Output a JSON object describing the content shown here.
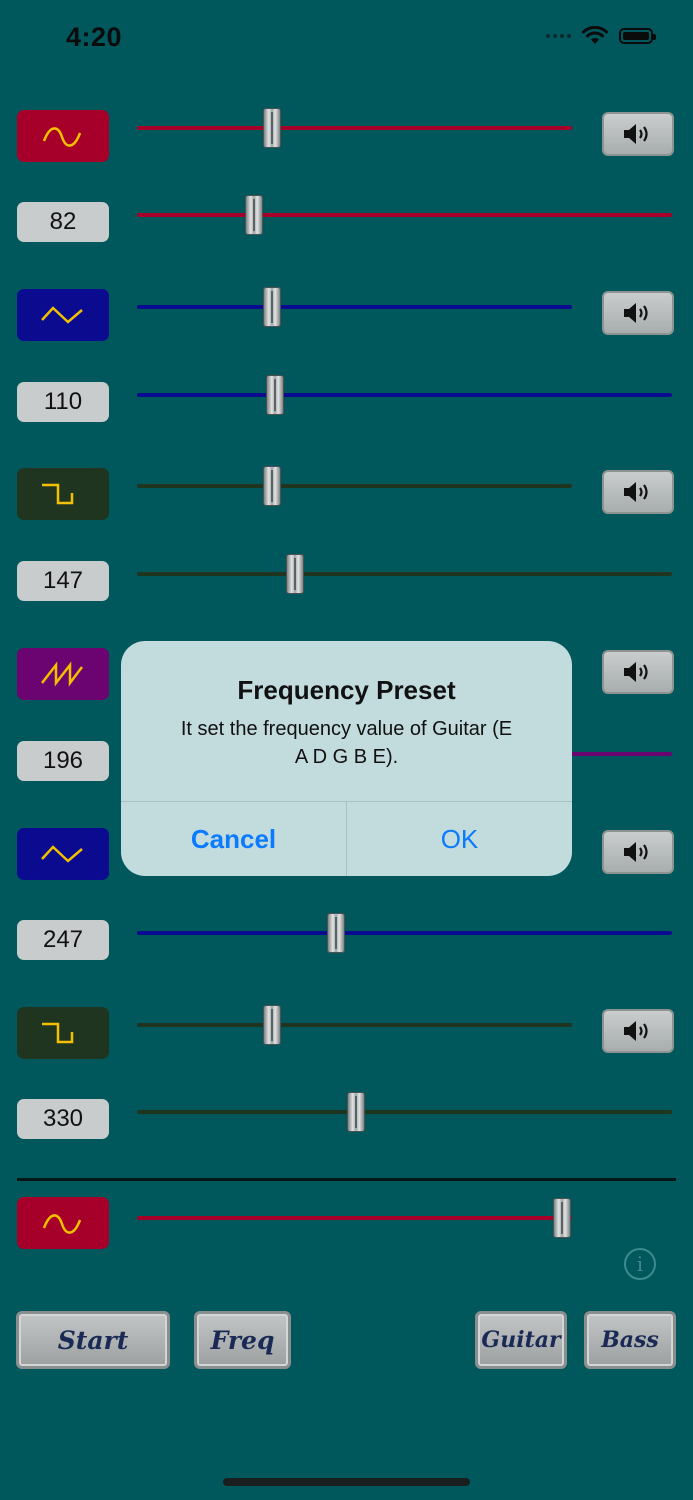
{
  "status_bar": {
    "time": "4:20"
  },
  "colors": {
    "sine": "#a6002a",
    "triangle": "#0a0b8e",
    "square": "#1f3520",
    "sawtooth": "#6b0470",
    "wave_glyph": "#f2c000",
    "accent": "#0a7aff"
  },
  "channels": [
    {
      "waveform": "sine",
      "frequency": "82"
    },
    {
      "waveform": "triangle",
      "frequency": "110"
    },
    {
      "waveform": "square",
      "frequency": "147"
    },
    {
      "waveform": "sawtooth",
      "frequency": "196"
    },
    {
      "waveform": "triangle",
      "frequency": "247"
    },
    {
      "waveform": "square",
      "frequency": "330"
    }
  ],
  "master": {
    "waveform": "sine"
  },
  "buttons": {
    "start": "Start",
    "freq": "Freq",
    "guitar": "Guitar",
    "bass": "Bass"
  },
  "dialog": {
    "title": "Frequency Preset",
    "message_line1": "It set the frequency value of Guitar (E",
    "message_line2": "A D G B E).",
    "cancel": "Cancel",
    "ok": "OK"
  },
  "icons": {
    "speaker": "speaker-icon",
    "info": "info-icon"
  }
}
